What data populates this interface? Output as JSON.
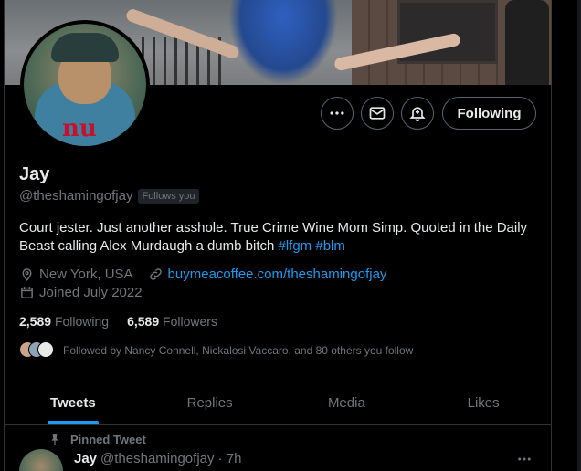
{
  "profile": {
    "name": "Jay",
    "handle": "@theshamingofjay",
    "follows_you": "Follows you",
    "bio_text": "Court jester. Just another asshole. True Crime Wine Mom Simp. Quoted in the Daily Beast calling Alex Murdaugh a dumb bitch ",
    "bio_tags": [
      "#lfgm",
      "#blm"
    ],
    "location": "New York, USA",
    "website": "buymeacoffee.com/theshamingofjay",
    "joined": "Joined July 2022",
    "following_count": "2,589",
    "following_label": "Following",
    "followers_count": "6,589",
    "followers_label": "Followers",
    "followed_by": "Followed by Nancy Connell, Nickalosi Vaccaro, and 80 others you follow"
  },
  "actions": {
    "following_label": "Following",
    "more_icon": "more-horizontal-icon",
    "message_icon": "mail-icon",
    "notify_icon": "bell-plus-icon"
  },
  "tabs": [
    {
      "label": "Tweets",
      "active": true
    },
    {
      "label": "Replies",
      "active": false
    },
    {
      "label": "Media",
      "active": false
    },
    {
      "label": "Likes",
      "active": false
    }
  ],
  "pinned_tweet": {
    "pinned_label": "Pinned Tweet",
    "author_name": "Jay",
    "author_handle_time": "@theshamingofjay · 7h"
  },
  "colors": {
    "accent": "#1d9bf0",
    "text": "#e7e9ea",
    "muted": "#71767b",
    "background": "#000000"
  }
}
